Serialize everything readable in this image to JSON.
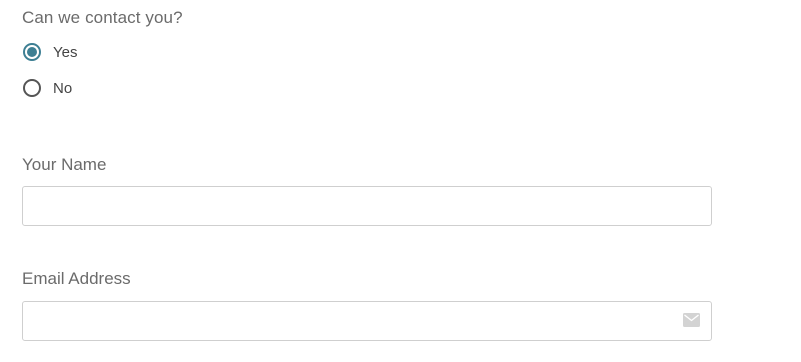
{
  "contact": {
    "question": "Can we contact you?",
    "options": [
      {
        "label": "Yes",
        "selected": true
      },
      {
        "label": "No",
        "selected": false
      }
    ]
  },
  "name_field": {
    "label": "Your Name",
    "value": "",
    "placeholder": ""
  },
  "email_field": {
    "label": "Email Address",
    "value": "",
    "placeholder": "",
    "icon": "mail-icon"
  },
  "colors": {
    "accent": "#3d7f93",
    "text": "#6b6b6b",
    "border": "#cfcfcf"
  }
}
